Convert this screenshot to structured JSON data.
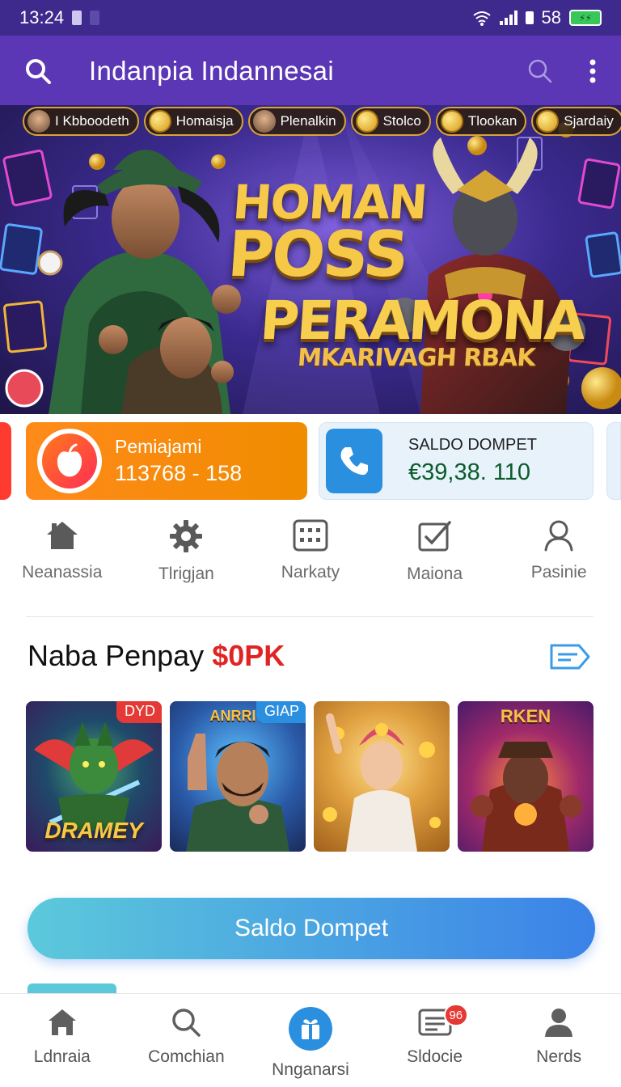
{
  "status_bar": {
    "time": "13:24",
    "battery": "58"
  },
  "app_bar": {
    "title": "Indanpia Indannesai"
  },
  "banner": {
    "chips": [
      {
        "label": "I Kbboodeth",
        "kind": "face"
      },
      {
        "label": "Homaisja",
        "kind": "coin"
      },
      {
        "label": "Plenalkin",
        "kind": "face"
      },
      {
        "label": "Stolco",
        "kind": "coin"
      },
      {
        "label": "Tlookan",
        "kind": "coin"
      },
      {
        "label": "Sjardaiy",
        "kind": "coin"
      }
    ],
    "headline_1": "HOMAN",
    "headline_2": "POSS",
    "headline_3": "PERAMONA",
    "headline_4": "MKARIVAGH RBAK"
  },
  "cards": {
    "card1": {
      "line1": "Pemiajami",
      "line2": "113768 - 158",
      "color": "#f08c00"
    },
    "card2": {
      "line1": "SALDO DOMPET",
      "line2": "€39,38. 110",
      "color": "#2b8fe0"
    }
  },
  "quick_menu": [
    {
      "label": "Neanassia",
      "icon": "home-icon"
    },
    {
      "label": "Tlrigjan",
      "icon": "gear-icon"
    },
    {
      "label": "Narkaty",
      "icon": "grid-icon"
    },
    {
      "label": "Maiona",
      "icon": "checklist-icon"
    },
    {
      "label": "Pasinie",
      "icon": "user-icon"
    }
  ],
  "section": {
    "title": "Naba Penpay",
    "accent": "$0PK",
    "accent_color": "#e02424"
  },
  "games": [
    {
      "badge": "DYD",
      "badge_color": "#e53935",
      "caption": "DRAMEY",
      "top_caption": ""
    },
    {
      "badge": "GIAP",
      "badge_color": "#2b8fe0",
      "caption": "",
      "top_caption": "ANRRIV"
    },
    {
      "badge": "",
      "badge_color": "",
      "caption": "",
      "top_caption": ""
    },
    {
      "badge": "",
      "badge_color": "",
      "caption": "",
      "top_caption": "RKEN"
    }
  ],
  "primary_button": {
    "label": "Saldo Dompet"
  },
  "bottom_nav": [
    {
      "label": "Ldnraia",
      "icon": "home-icon"
    },
    {
      "label": "Comchian",
      "icon": "search-icon"
    },
    {
      "label": "Nnganarsi",
      "icon": "gift-icon"
    },
    {
      "label": "Sldocie",
      "icon": "inbox-icon",
      "badge": "96"
    },
    {
      "label": "Nerds",
      "icon": "user-icon"
    }
  ],
  "colors": {
    "status_bar": "#3d2a8c",
    "app_bar": "#5b36b5",
    "accent_blue": "#2b8fe0",
    "accent_orange": "#f08c00"
  }
}
